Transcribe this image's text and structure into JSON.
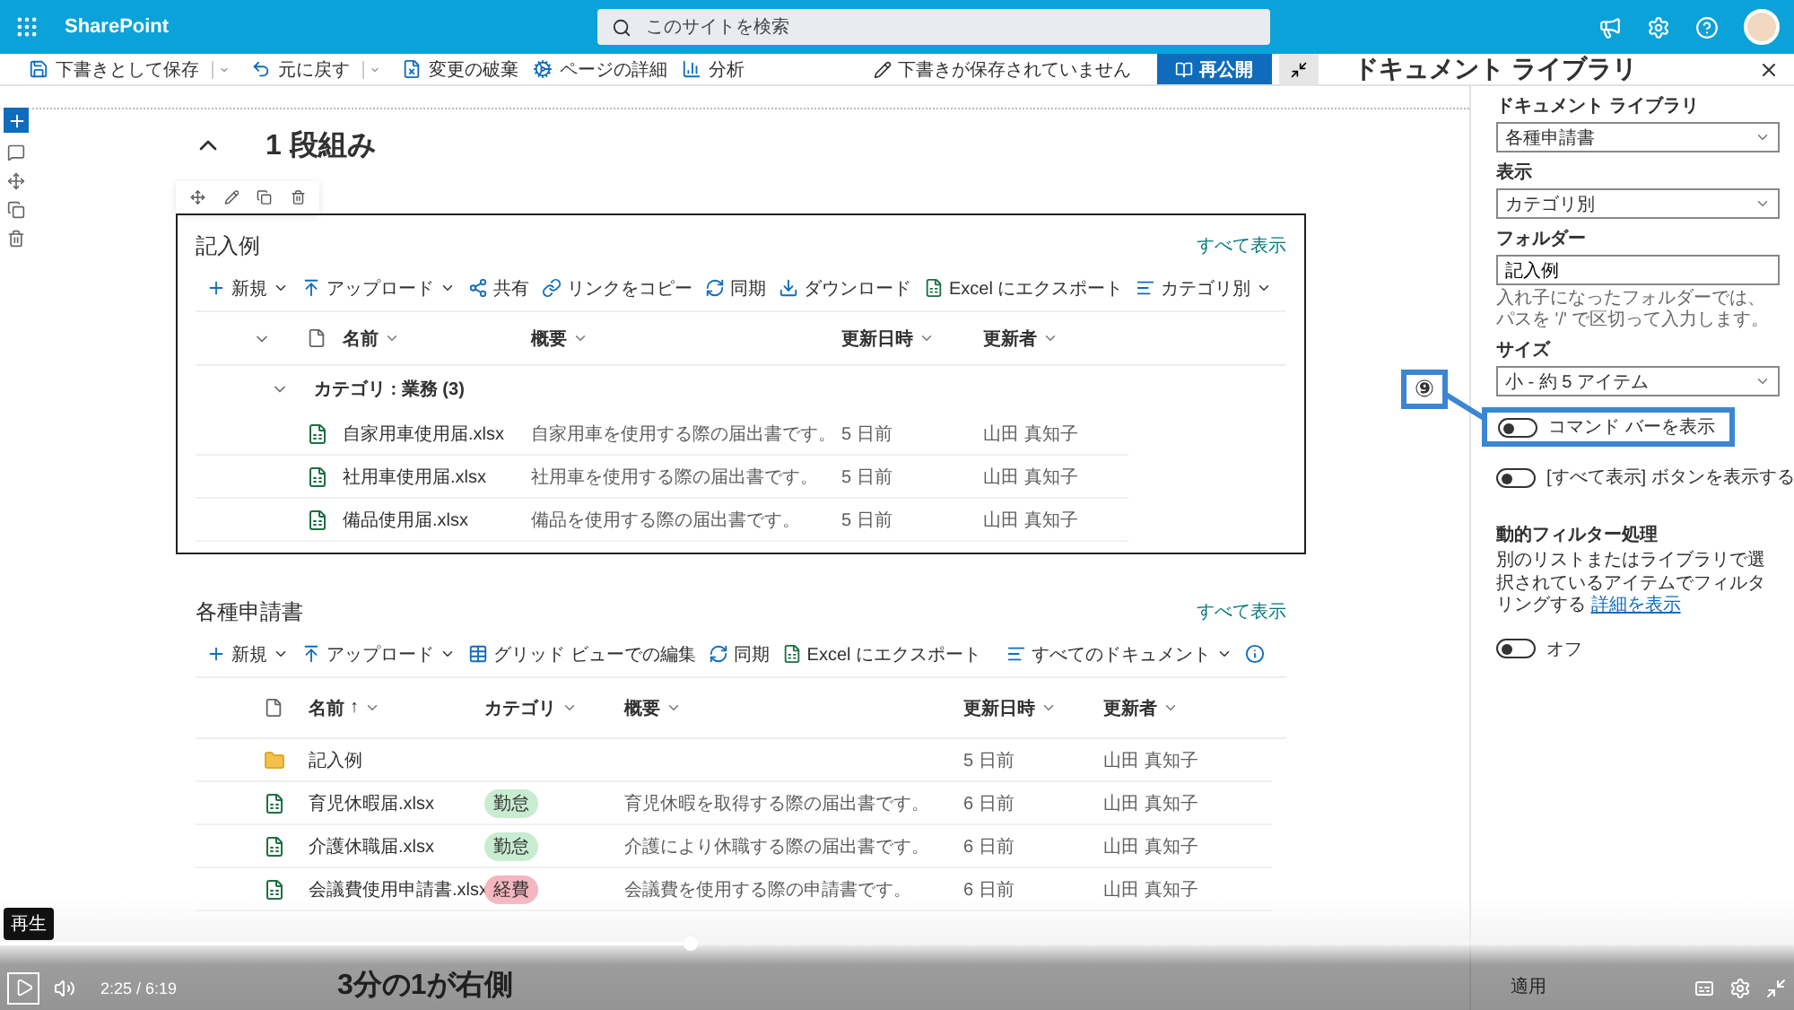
{
  "app": {
    "name": "SharePoint",
    "search_placeholder": "このサイトを検索"
  },
  "toolbar": {
    "items": [
      {
        "kind": "save",
        "label": "下書きとして保存",
        "menu": true
      },
      {
        "kind": "undo",
        "label": "元に戻す",
        "menu": true
      },
      {
        "kind": "discard",
        "label": "変更の破棄",
        "menu": false
      },
      {
        "kind": "details",
        "label": "ページの詳細",
        "menu": false
      },
      {
        "kind": "analytics",
        "label": "分析",
        "menu": false
      }
    ],
    "status": "下書きが保存されていません",
    "publish": "再公開"
  },
  "section": {
    "title": "1 段組み",
    "expanded": true
  },
  "webparts": [
    {
      "title": "記入例",
      "show_all": "すべて表示",
      "selected": true,
      "commands": [
        {
          "kind": "new",
          "label": "新規",
          "menu": true
        },
        {
          "kind": "upload",
          "label": "アップロード",
          "menu": true
        },
        {
          "kind": "share",
          "label": "共有",
          "menu": false
        },
        {
          "kind": "link",
          "label": "リンクをコピー",
          "menu": false
        },
        {
          "kind": "sync",
          "label": "同期",
          "menu": false
        },
        {
          "kind": "download",
          "label": "ダウンロード",
          "menu": false
        },
        {
          "kind": "excel",
          "label": "Excel にエクスポート",
          "menu": false
        }
      ],
      "view": "カテゴリ別",
      "columns": [
        {
          "label": "名前"
        },
        {
          "label": "概要"
        },
        {
          "label": "更新日時"
        },
        {
          "label": "更新者"
        }
      ],
      "group": {
        "label": "カテゴリ : 業務",
        "count": "(3)",
        "expanded": true
      },
      "rows": [
        {
          "kind": "excel",
          "name": "自家用車使用届.xlsx",
          "summary": "自家用車を使用する際の届出書です。",
          "modified": "5 日前",
          "author": "山田 真知子"
        },
        {
          "kind": "excel",
          "name": "社用車使用届.xlsx",
          "summary": "社用車を使用する際の届出書です。",
          "modified": "5 日前",
          "author": "山田 真知子"
        },
        {
          "kind": "excel",
          "name": "備品使用届.xlsx",
          "summary": "備品を使用する際の届出書です。",
          "modified": "5 日前",
          "author": "山田 真知子"
        }
      ]
    },
    {
      "title": "各種申請書",
      "show_all": "すべて表示",
      "selected": false,
      "commands": [
        {
          "kind": "new",
          "label": "新規",
          "menu": true
        },
        {
          "kind": "upload",
          "label": "アップロード",
          "menu": true
        },
        {
          "kind": "grid",
          "label": "グリッド ビューでの編集",
          "menu": false
        },
        {
          "kind": "sync",
          "label": "同期",
          "menu": false
        },
        {
          "kind": "excel",
          "label": "Excel にエクスポート",
          "menu": false
        }
      ],
      "view": "すべてのドキュメント",
      "columns": [
        {
          "label": "名前",
          "sort": "↑"
        },
        {
          "label": "カテゴリ"
        },
        {
          "label": "概要"
        },
        {
          "label": "更新日時"
        },
        {
          "label": "更新者"
        }
      ],
      "rows": [
        {
          "kind": "folder",
          "name": "記入例",
          "modified": "5 日前",
          "author": "山田 真知子"
        },
        {
          "kind": "excel",
          "name": "育児休暇届.xlsx",
          "category": {
            "label": "勤怠",
            "color": "#c8ecd0"
          },
          "summary": "育児休暇を取得する際の届出書です。",
          "modified": "6 日前",
          "author": "山田 真知子"
        },
        {
          "kind": "excel",
          "name": "介護休職届.xlsx",
          "category": {
            "label": "勤怠",
            "color": "#c8ecd0"
          },
          "summary": "介護により休職する際の届出書です。",
          "modified": "6 日前",
          "author": "山田 真知子"
        },
        {
          "kind": "excel",
          "name": "会議費使用申請書.xlsx",
          "category": {
            "label": "経費",
            "color": "#f4b6bf"
          },
          "summary": "会議費を使用する際の申請書です。",
          "modified": "6 日前",
          "author": "山田 真知子"
        }
      ]
    }
  ],
  "next_section": {
    "title": "3分の1が右側"
  },
  "panel": {
    "title": "ドキュメント ライブラリ",
    "fields": [
      {
        "kind": "select",
        "label": "ドキュメント ライブラリ",
        "value": "各種申請書"
      },
      {
        "kind": "select",
        "label": "表示",
        "value": "カテゴリ別"
      },
      {
        "kind": "input",
        "label": "フォルダー",
        "value": "記入例",
        "hint": "入れ子になったフォルダーでは、パスを '/' で区切って入力します。"
      },
      {
        "kind": "select",
        "label": "サイズ",
        "value": "小 - 約 5 アイテム"
      },
      {
        "kind": "toggle",
        "label": "コマンド バーを表示",
        "on": false,
        "highlighted": true
      },
      {
        "kind": "toggle",
        "label": "[すべて表示] ボタンを表示する",
        "on": false,
        "highlighted": false
      }
    ],
    "filter": {
      "heading": "動的フィルター処理",
      "text": "別のリストまたはライブラリで選択されているアイテムでフィルタリングする",
      "link": "詳細を表示",
      "on": false,
      "state": "オフ"
    },
    "apply": "適用"
  },
  "callout": {
    "number": "⑨"
  },
  "player": {
    "tooltip": "再生",
    "time": "2:25 / 6:19",
    "level": 0.385
  }
}
